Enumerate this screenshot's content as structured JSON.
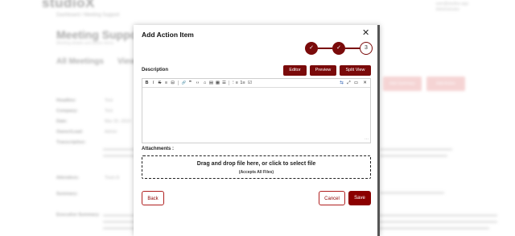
{
  "background": {
    "app_logo": "studioX",
    "breadcrumb": "Dashboard  /  Meeting Support",
    "user_line1": "user@studiox.app",
    "user_line2": "Administrator",
    "page_title": "Meeting Support",
    "page_subtitle": "Meeting details and action items",
    "tabs": [
      "All Meetings",
      "View"
    ],
    "buttons": [
      "Add Summary",
      "Add Action"
    ],
    "rows": [
      {
        "label": "Headline:",
        "value": "Test"
      },
      {
        "label": "Company:",
        "value": "Test"
      },
      {
        "label": "Date:",
        "value": "Mar 20, 2023"
      },
      {
        "label": "Owner/Lead:",
        "value": "Admin"
      },
      {
        "label": "Transcription:",
        "value": ""
      },
      {
        "label": "Attendees:",
        "value": "Team A"
      },
      {
        "label": "Summary:",
        "value": ""
      },
      {
        "label": "Executive Summary:",
        "value": ""
      }
    ]
  },
  "modal": {
    "title": "Add Action Item",
    "steps": [
      {
        "state": "done",
        "label": "✓"
      },
      {
        "state": "done",
        "label": "✓"
      },
      {
        "state": "current",
        "label": "3"
      }
    ],
    "description_label": "Description",
    "mode_buttons": [
      "Editor",
      "Preview",
      "Split View"
    ],
    "toolbar_icons": [
      "bold-icon",
      "italic-icon",
      "strikethrough-icon",
      "hr-icon",
      "quote-icon",
      "link-icon",
      "quote-mark-icon",
      "code-icon",
      "code-block-icon",
      "comment-icon",
      "image-icon",
      "table-icon",
      "unordered-list-icon",
      "ordered-list-icon",
      "task-list-icon"
    ],
    "toolbar_glyphs": [
      "B",
      "I",
      "S",
      "≡",
      "⊟",
      "🔗",
      "❞",
      "‹›",
      "⌂",
      "▤",
      "▦",
      "☰",
      "⋮≡",
      "1≡",
      "☑"
    ],
    "toolbar_right_icons": [
      "split-view-icon",
      "fullscreen-icon",
      "preview-icon",
      "close-editor-icon"
    ],
    "toolbar_right_glyphs": [
      "⇆",
      "⤢",
      "▭",
      "✕"
    ],
    "description_value": "",
    "attachments_label": "Attachments :",
    "dropzone_text": "Drag and drop file here, or click to select file",
    "dropzone_subtext": "(Accepts All Files)",
    "back_label": "Back",
    "cancel_label": "Cancel",
    "save_label": "Save",
    "close_glyph": "✕"
  },
  "colors": {
    "primary": "#7a0a0a",
    "accent": "#8b0000"
  }
}
